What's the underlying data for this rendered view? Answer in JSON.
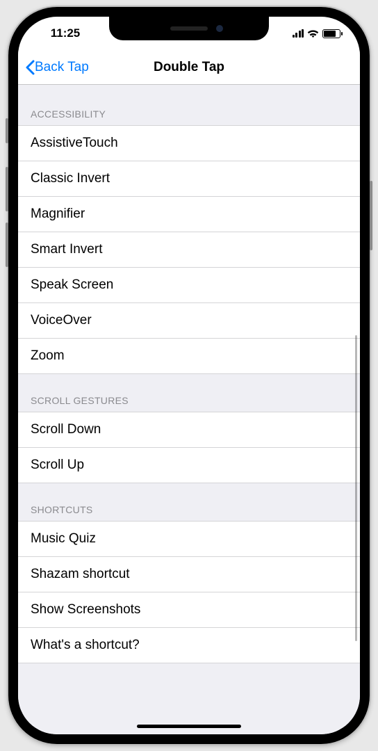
{
  "status": {
    "time": "11:25"
  },
  "nav": {
    "back": "Back Tap",
    "title": "Double Tap"
  },
  "sections": [
    {
      "header": "ACCESSIBILITY",
      "items": [
        "AssistiveTouch",
        "Classic Invert",
        "Magnifier",
        "Smart Invert",
        "Speak Screen",
        "VoiceOver",
        "Zoom"
      ]
    },
    {
      "header": "SCROLL GESTURES",
      "items": [
        "Scroll Down",
        "Scroll Up"
      ]
    },
    {
      "header": "SHORTCUTS",
      "items": [
        "Music Quiz",
        "Shazam shortcut",
        "Show Screenshots",
        "What's a shortcut?"
      ]
    }
  ]
}
